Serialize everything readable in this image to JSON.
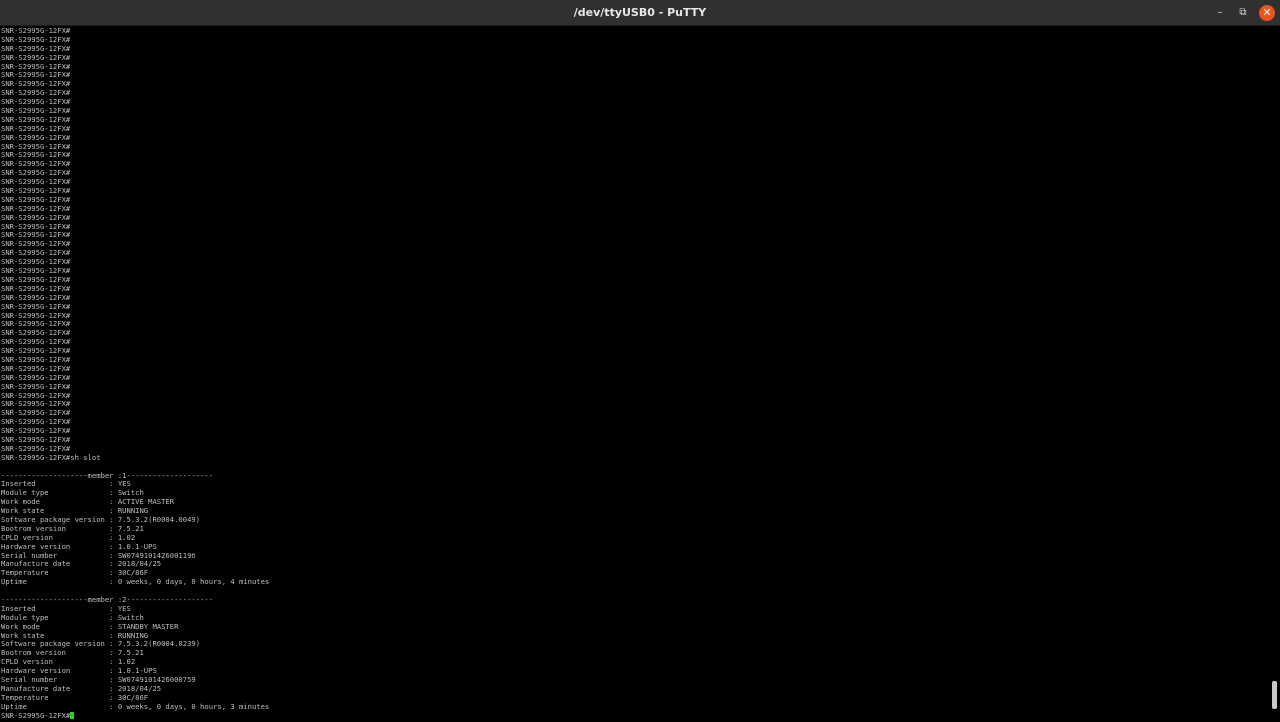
{
  "window": {
    "title": "/dev/ttyUSB0 - PuTTY",
    "buttons": {
      "minimize": "–",
      "maximize": "⧉",
      "close": "✕"
    }
  },
  "colors": {
    "titlebar": "#303030",
    "terminal_bg": "#000000",
    "terminal_fg": "#bfbfbf",
    "cursor": "#1fd81f",
    "close_button": "#e95420",
    "scroll_thumb": "#c8c8c8"
  },
  "terminal": {
    "prompt": "SNR-S2995G-12FX#",
    "repeated_prompt_count": 48,
    "lines": [
      "SNR-S2995G-12FX#sh slot",
      "",
      "--------------------member :1--------------------",
      "Inserted                 : YES",
      "Module type              : Switch",
      "Work mode                : ACTIVE MASTER",
      "Work state               : RUNNING",
      "Software package version : 7.5.3.2(R0004.0049)",
      "Bootrom version          : 7.5.21",
      "CPLD version             : 1.02",
      "Hardware version         : 1.0.1-UPS",
      "Serial number            : SW074910142600119б",
      "Manufacture date         : 2018/04/25",
      "Temperature              : 30C/86F",
      "Uptime                   : 0 weeks, 0 days, 0 hours, 4 minutes",
      "",
      "--------------------member :2--------------------",
      "Inserted                 : YES",
      "Module type              : Switch",
      "Work mode                : STANDBY MASTER",
      "Work state               : RUNNING",
      "Software package version : 7.5.3.2(R0004.0239)",
      "Bootrom version          : 7.5.21",
      "CPLD version             : 1.02",
      "Hardware version         : 1.0.1-UPS",
      "Serial number            : SW0749101426000759",
      "Manufacture date         : 2018/04/25",
      "Temperature              : 30C/86F",
      "Uptime                   : 0 weeks, 0 days, 0 hours, 3 minutes"
    ],
    "active_prompt": "SNR-S2995G-12FX#"
  },
  "scrollbar": {
    "position_fraction": 0.98,
    "visible_fraction": 0.04
  }
}
